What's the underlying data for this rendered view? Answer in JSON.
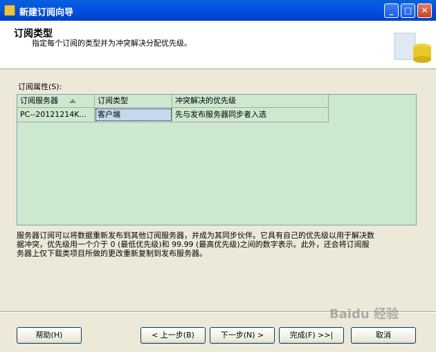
{
  "window": {
    "title": "新建订阅向导"
  },
  "header": {
    "title": "订阅类型",
    "subtitle": "指定每个订阅的类型并为冲突解决分配优先级。"
  },
  "grid": {
    "label": "订阅属性(S):",
    "columns": [
      "订阅服务器",
      "订阅类型",
      "冲突解决的优先级"
    ],
    "rows": [
      [
        "PC--20121214K...",
        "客户端",
        "先与发布服务器同步者入选"
      ]
    ]
  },
  "description": [
    "服务器订阅可以将数据重新发布到其他订阅服务器，并成为其同步伙伴。它具有自己的优先级以用于解决数",
    "据冲突，优先级用一个介于 0 (最低优先级)和 99.99 (最高优先级)之间的数字表示。此外，还会将订阅服",
    "务器上仅下载类项目所做的更改重新复制到发布服务器。"
  ],
  "buttons": {
    "help": "帮助(H)",
    "back": "< 上一步(B)",
    "next": "下一步(N) >",
    "finish": "完成(F) >>|",
    "cancel": "取消"
  },
  "watermark": "Baidu 经验"
}
